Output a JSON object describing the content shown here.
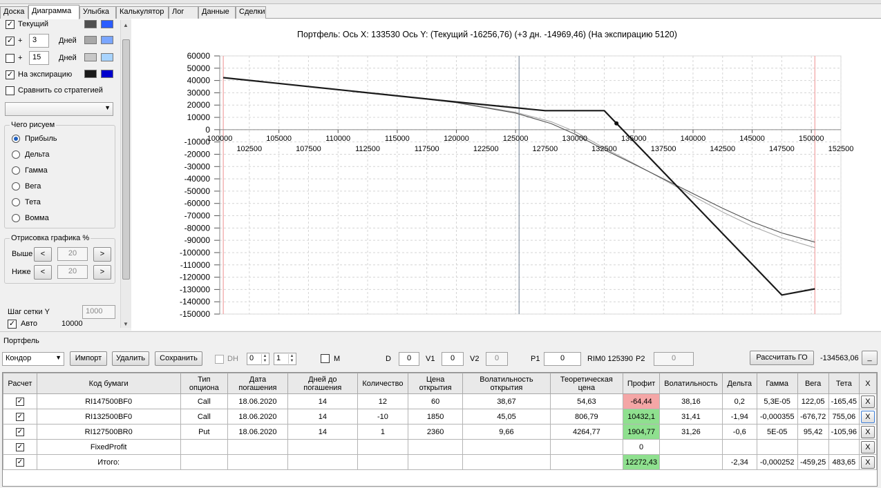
{
  "tabs": [
    "Доска",
    "Диаграмма",
    "Улыбка",
    "Калькулятор",
    "Лог",
    "Данные",
    "Сделки"
  ],
  "active_tab": "Диаграмма",
  "left": {
    "current_label": "Текущий",
    "plus_label": "+",
    "days_label": "Дней",
    "days1": "3",
    "days2": "15",
    "expiry_label": "На экспирацию",
    "compare_label": "Сравнить со стратегией",
    "compare_value": "",
    "colors": {
      "current": [
        "#505050",
        "#2b5cff"
      ],
      "days1": [
        "#a8a8a8",
        "#7aa6ff"
      ],
      "days2": [
        "#c8c8c8",
        "#a8d4ff"
      ],
      "expiry": [
        "#1a1a1a",
        "#0000cc"
      ]
    },
    "draw_group_title": "Чего рисуем",
    "radios": [
      "Прибыль",
      "Дельта",
      "Гамма",
      "Вега",
      "Тета",
      "Вомма"
    ],
    "radio_selected": "Прибыль",
    "render_group_title": "Отрисовка графика %",
    "above_label": "Выше",
    "below_label": "Ниже",
    "above_value": "20",
    "below_value": "20",
    "lt": "<",
    "gt": ">",
    "grid_step_label": "Шаг сетки Y",
    "grid_step_value": "1000",
    "auto_label": "Авто",
    "auto_value": "10000"
  },
  "chart_title": "Портфель: Ось X: 133530 Ось Y:  (Текущий -16256,76)  (+3 дн. -14969,46)  (На экспирацию 5120)",
  "chart_data": {
    "type": "line",
    "title": "Портфель: Ось X: 133530 Ось Y:  (Текущий -16256,76)  (+3 дн. -14969,46)  (На экспирацию 5120)",
    "xlim": [
      100000,
      152500
    ],
    "ylim": [
      -150000,
      60000
    ],
    "x_ticks_top": [
      "100000",
      "105000",
      "110000",
      "115000",
      "120000",
      "125000",
      "130000",
      "135000",
      "140000",
      "145000",
      "150000"
    ],
    "x_ticks_bottom": [
      "102500",
      "107500",
      "112500",
      "117500",
      "122500",
      "127500",
      "132500",
      "137500",
      "142500",
      "147500",
      "152500"
    ],
    "y_ticks": [
      60000,
      50000,
      40000,
      30000,
      20000,
      10000,
      0,
      -10000,
      -20000,
      -30000,
      -40000,
      -50000,
      -60000,
      -70000,
      -80000,
      -90000,
      -100000,
      -110000,
      -120000,
      -130000,
      -140000,
      -150000
    ],
    "y_tick_labels": [
      "60000",
      "50000",
      "40000",
      "30000",
      "20000",
      "10000",
      "0",
      "-10000",
      "-20000",
      "-30000",
      "-40000",
      "-50000",
      "-60000",
      "-70000",
      "-80000",
      "-90000",
      "-100000",
      "-110000",
      "-120000",
      "-130000",
      "-140000",
      "-150000"
    ],
    "vertical_lines": [
      {
        "x": 100300,
        "color": "#f0a0a0"
      },
      {
        "x": 125300,
        "color": "#8090a0"
      },
      {
        "x": 150300,
        "color": "#f0a0a0"
      }
    ],
    "marker": {
      "x": 133530,
      "y": 5120
    },
    "series": [
      {
        "color": "#1a1a1a",
        "width": 2.2,
        "x": [
          100300,
          119500,
          127500,
          132500,
          147500,
          150300
        ],
        "y": [
          42300,
          23000,
          15500,
          15500,
          -134500,
          -129500
        ]
      },
      {
        "color": "#505050",
        "width": 1.1,
        "x": [
          100300,
          115000,
          120000,
          125000,
          128000,
          130000,
          132500,
          135000,
          137500,
          140000,
          142500,
          145000,
          147500,
          150300
        ],
        "y": [
          42300,
          27700,
          22000,
          13500,
          5000,
          -3500,
          -16256,
          -28000,
          -40000,
          -52000,
          -64000,
          -75000,
          -84000,
          -91500
        ]
      },
      {
        "color": "#a8a8a8",
        "width": 1.1,
        "x": [
          100300,
          115000,
          120000,
          125000,
          128000,
          130000,
          132500,
          135000,
          137500,
          140000,
          142500,
          145000,
          147500,
          150300
        ],
        "y": [
          42300,
          27800,
          22200,
          14200,
          6500,
          -1500,
          -14969,
          -27500,
          -40500,
          -54000,
          -67000,
          -78500,
          -88000,
          -96000
        ]
      }
    ]
  },
  "portfolio": {
    "label": "Портфель",
    "strategy": "Кондор",
    "import_btn": "Импорт",
    "delete_btn": "Удалить",
    "save_btn": "Сохранить",
    "dh_label": "DH",
    "spin1": "0",
    "spin2": "1",
    "m_label": "M",
    "d_label": "D",
    "d_value": "0",
    "v1_label": "V1",
    "v1_value": "0",
    "v2_label": "V2",
    "v2_value": "0",
    "p1_label": "P1",
    "p1_value": "0",
    "rim_label": "RIM0 125390",
    "p2_label": "P2",
    "p2_value": "0",
    "calc_btn": "Рассчитать ГО",
    "go_value": "-134563,06",
    "more_btn": "_"
  },
  "table": {
    "headers": [
      "Расчет",
      "Код бумаги",
      "Тип опциона",
      "Дата погашения",
      "Дней до погашения",
      "Количество",
      "Цена открытия",
      "Волатильность открытия",
      "Теоретическая цена",
      "Профит",
      "Волатильность",
      "Дельта",
      "Гамма",
      "Вега",
      "Тета",
      "X"
    ],
    "rows": [
      {
        "code": "RI147500BF0",
        "type": "Call",
        "date": "18.06.2020",
        "days": "14",
        "qty": "12",
        "open": "60",
        "vol_open": "38,67",
        "theo": "54,63",
        "profit": "-64,44",
        "vol": "38,16",
        "delta": "0,2",
        "gamma": "5,3E-05",
        "vega": "122,05",
        "theta": "-165,45",
        "x": "X"
      },
      {
        "code": "RI132500BF0",
        "type": "Call",
        "date": "18.06.2020",
        "days": "14",
        "qty": "-10",
        "open": "1850",
        "vol_open": "45,05",
        "theo": "806,79",
        "profit": "10432,1",
        "vol": "31,41",
        "delta": "-1,94",
        "gamma": "-0,000355",
        "vega": "-676,72",
        "theta": "755,06",
        "x": "X"
      },
      {
        "code": "RI127500BR0",
        "type": "Put",
        "date": "18.06.2020",
        "days": "14",
        "qty": "1",
        "open": "2360",
        "vol_open": "9,66",
        "theo": "4264,77",
        "profit": "1904,77",
        "vol": "31,26",
        "delta": "-0,6",
        "gamma": "5E-05",
        "vega": "95,42",
        "theta": "-105,96",
        "x": "X"
      }
    ],
    "fixed_row": {
      "code": "FixedProfit",
      "profit": "0",
      "x": "X"
    },
    "total_row": {
      "code": "Итого:",
      "profit": "12272,43",
      "delta": "-2,34",
      "gamma": "-0,000252",
      "vega": "-459,25",
      "theta": "483,65",
      "x": "X"
    }
  }
}
